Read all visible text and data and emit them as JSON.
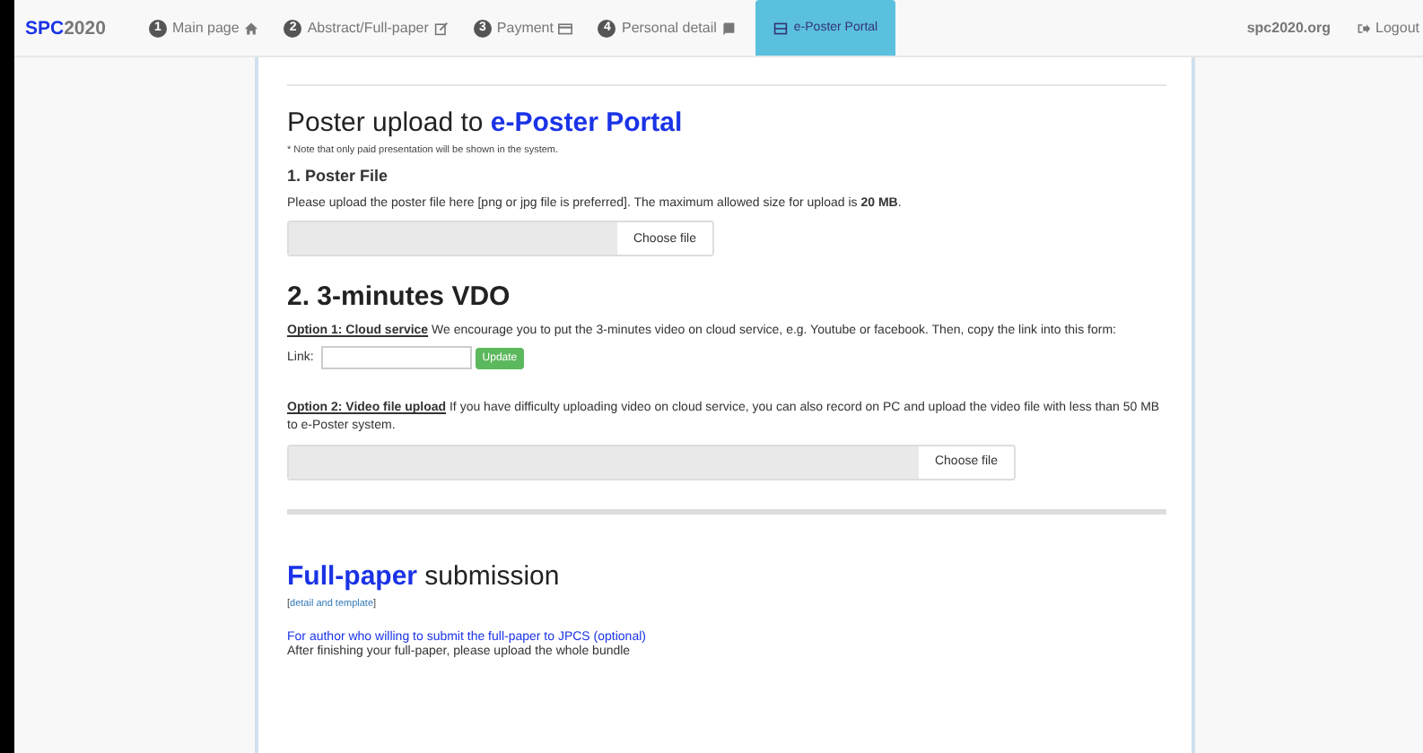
{
  "navbar": {
    "brand": {
      "accent": "SPC",
      "rest": "2020"
    },
    "items": [
      {
        "number": "1",
        "label": "Main page",
        "selected": false
      },
      {
        "number": "2",
        "label": "Abstract/Full-paper",
        "selected": false
      },
      {
        "number": "3",
        "label": "Payment",
        "selected": false
      },
      {
        "number": "4",
        "label": "Personal detail",
        "selected": false
      },
      {
        "label": "e-Poster Portal",
        "selected": true
      }
    ],
    "site": "spc2020.org",
    "logout": "Logout"
  },
  "poster": {
    "title_plain": "Poster upload to ",
    "title_link": "e-Poster Portal",
    "note": "* Note that only paid presentation will be shown in the system.",
    "file_heading": "1. Poster File",
    "file_text": "Please upload the poster file here [png or jpg file is preferred]. The maximum allowed size for upload is **20 MB**.",
    "file_button": "Choose file",
    "vdo_heading": "2. 3-minutes VDO",
    "option1_label": "Option 1: Cloud service",
    "option1_text": " We encourage you to put the 3-minutes video on cloud service, e.g. Youtube or facebook. Then, copy the link into this form:",
    "link_label": "Link:",
    "update_button": "Update",
    "option2_label": "Option 2: Video file upload",
    "option2_text": " If you have difficulty uploading video on cloud service, you can also record on PC and upload the video file with less than 50 MB to e-Poster system.",
    "video_button": "Choose file"
  },
  "fullpaper": {
    "title_link": "Full-paper",
    "title_plain": " submission",
    "detail_open": "[",
    "detail_link": "detail and template",
    "detail_close": "]",
    "jpcs_link": "For author who willing to submit the full-paper to JPCS (optional)",
    "after": "After finishing your full-paper, please upload the whole bundle"
  }
}
